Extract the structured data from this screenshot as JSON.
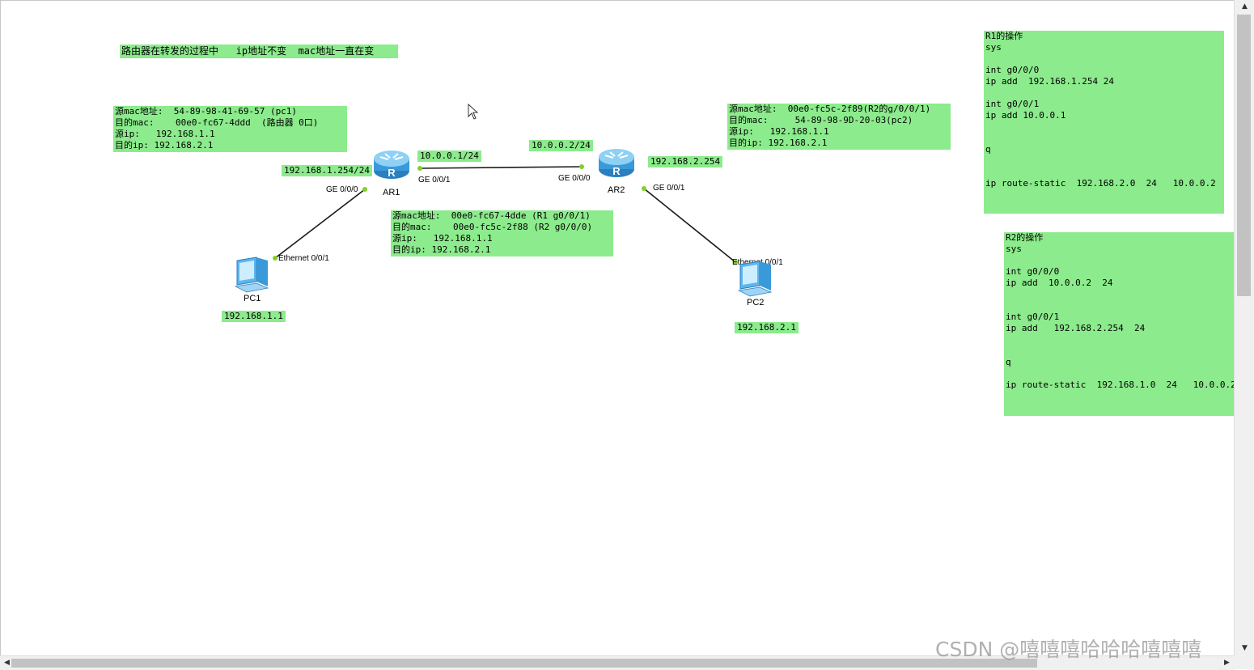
{
  "title_note": "路由器在转发的过程中   ip地址不变  mac地址一直在变",
  "notes": {
    "pc1_frame": "源mac地址:  54-89-98-41-69-57 (pc1)\n目的mac:    00e0-fc67-4ddd  (路由器 0口)\n源ip:   192.168.1.1\n目的ip: 192.168.2.1",
    "r1r2_frame": "源mac地址:  00e0-fc67-4dde (R1 g0/0/1)\n目的mac:    00e0-fc5c-2f88 (R2 g0/0/0)\n源ip:   192.168.1.1\n目的ip: 192.168.2.1",
    "r2_frame": "源mac地址:  00e0-fc5c-2f89(R2的g/0/0/1)\n目的mac:     54-89-98-9D-20-03(pc2)\n源ip:   192.168.1.1\n目的ip: 192.168.2.1",
    "r1_ops": "R1的操作\nsys\n\nint g0/0/0\nip add  192.168.1.254 24\n\nint g0/0/1\nip add 10.0.0.1\n\n\nq\n\n\nip route-static  192.168.2.0  24   10.0.0.2",
    "r2_ops": "R2的操作\nsys\n\nint g0/0/0\nip add  10.0.0.2  24\n\n\nint g0/0/1\nip add   192.168.2.254  24\n\n\nq\n\nip route-static  192.168.1.0  24   10.0.0.2"
  },
  "devices": {
    "ar1": "AR1",
    "ar2": "AR2",
    "pc1": "PC1",
    "pc2": "PC2"
  },
  "ip_tags": {
    "ar1_left": "192.168.1.254/24",
    "ar1_right": "10.0.0.1/24",
    "ar2_left": "10.0.0.2/24",
    "ar2_right": "192.168.2.254",
    "pc1": "192.168.1.1",
    "pc2": "192.168.2.1"
  },
  "ports": {
    "ar1_g000": "GE 0/0/0",
    "ar1_g001": "GE 0/0/1",
    "ar2_g000": "GE 0/0/0",
    "ar2_g001": "GE 0/0/1",
    "pc1_eth": "Ethernet 0/0/1",
    "pc2_eth": "Ethernet 0/0/1"
  },
  "colors": {
    "note_bg": "#8ceb8c",
    "link": "#1a1a1a",
    "port_dot": "#7ed321",
    "router_body": "#3a9ad9"
  },
  "watermark": "CSDN @嘻嘻嘻哈哈哈嘻嘻嘻"
}
